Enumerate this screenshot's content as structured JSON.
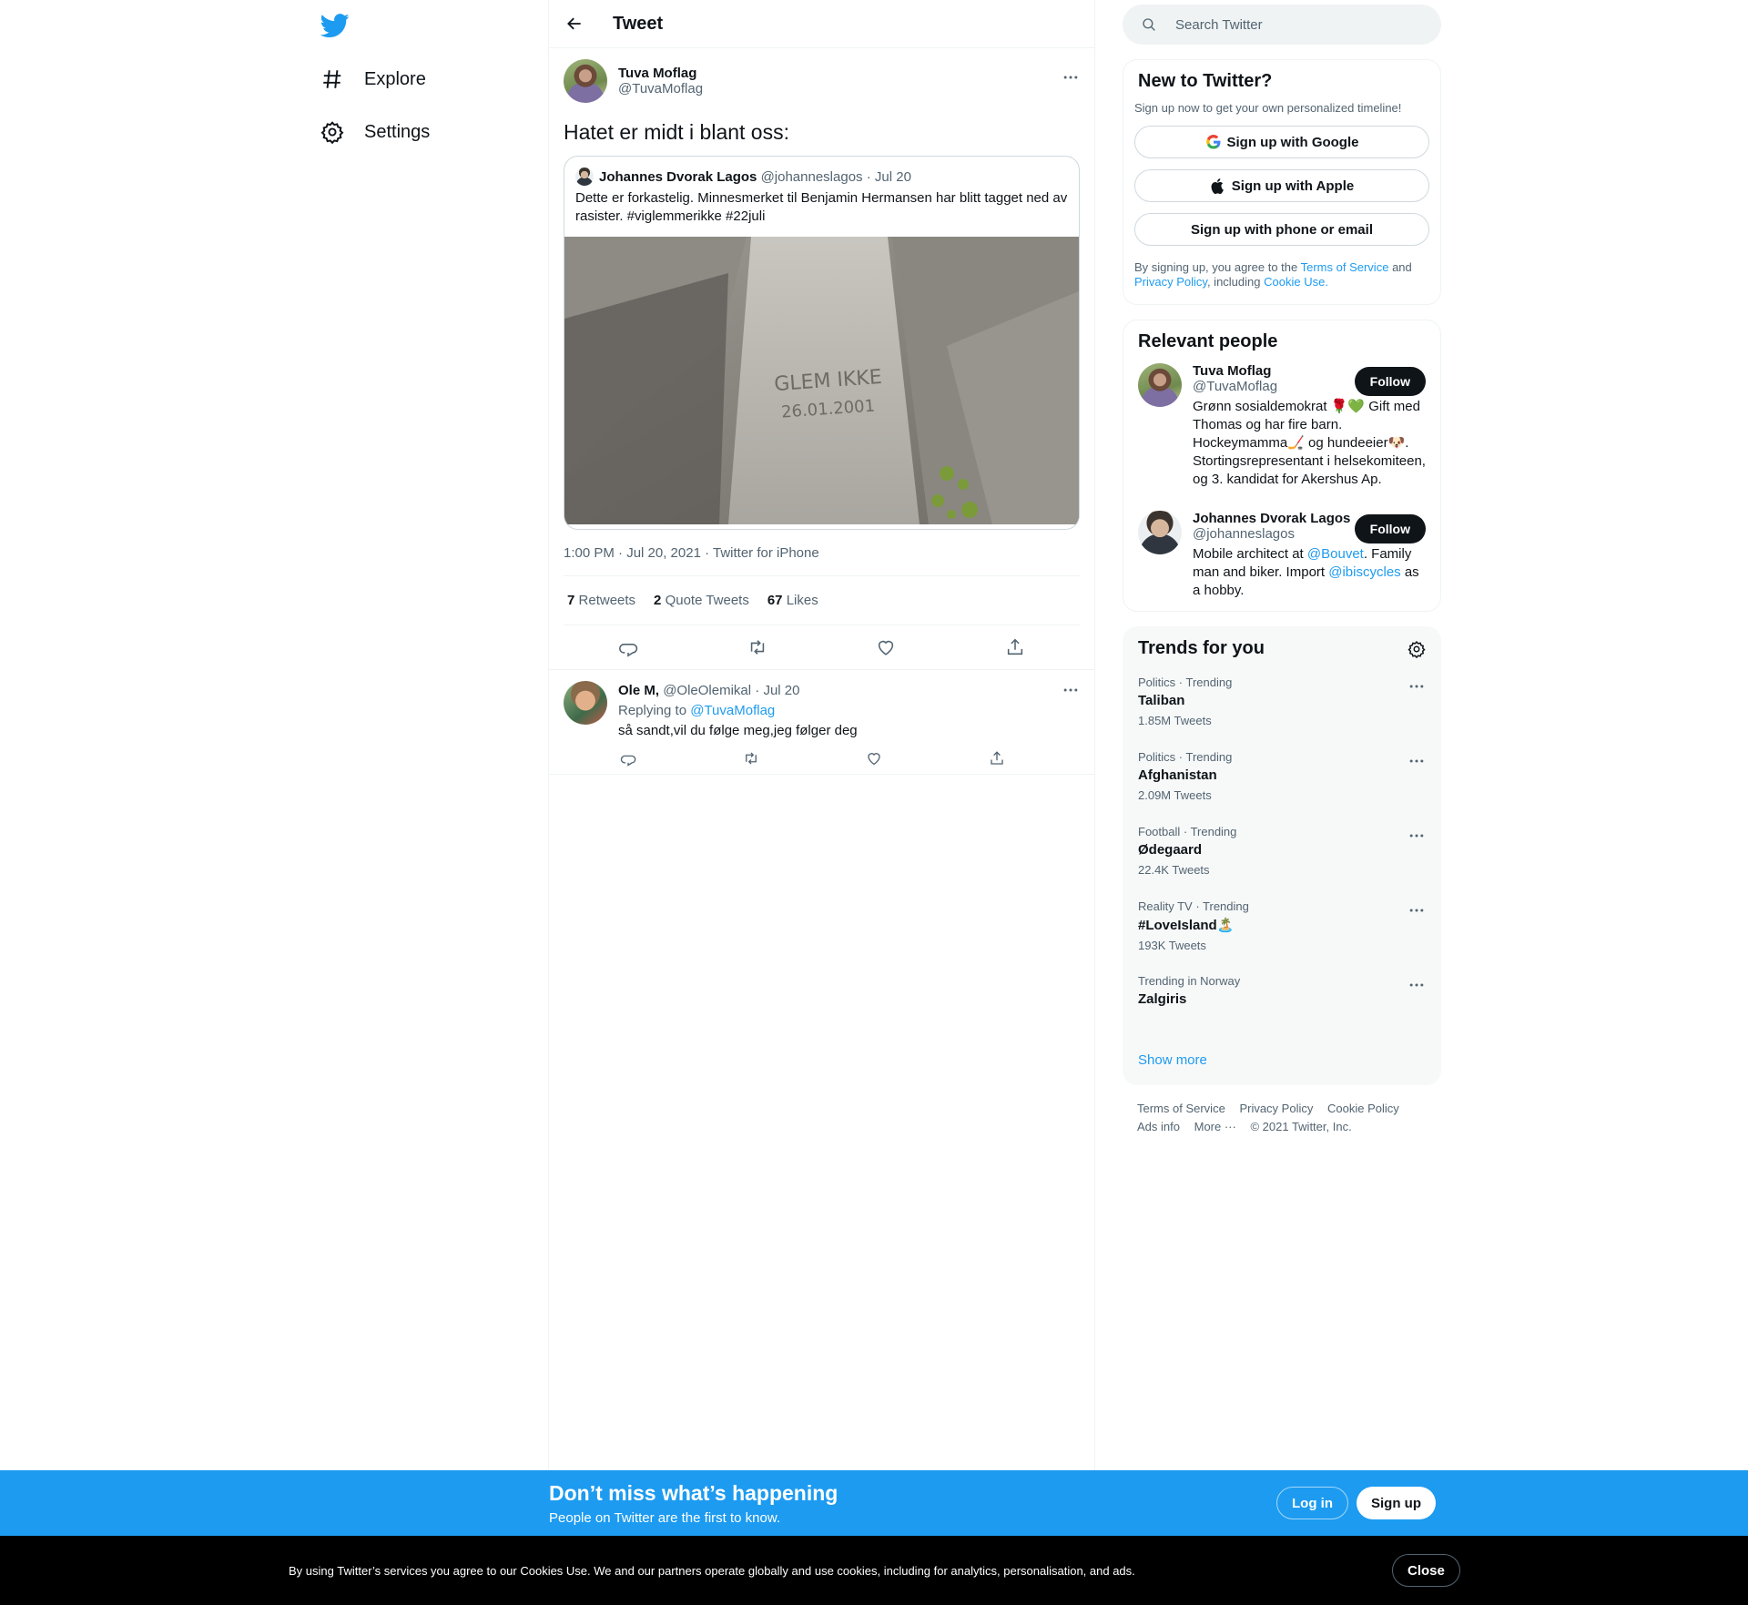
{
  "nav": {
    "items": [
      {
        "label": "Explore"
      },
      {
        "label": "Settings"
      }
    ]
  },
  "header": {
    "title": "Tweet"
  },
  "tweet": {
    "author_name": "Tuva Moflag",
    "author_handle": "@TuvaMoflag",
    "text": "Hatet er midt i blant oss:",
    "quote": {
      "author_name": "Johannes Dvorak Lagos",
      "author_handle": "@johanneslagos",
      "date": "· Jul 20",
      "text": "Dette er forkastelig. Minnesmerket til Benjamin Hermansen har blitt tagget ned av rasister. #viglemmerikke #22juli",
      "image_line1": "GLEM IKKE",
      "image_line2": "26.01.2001"
    },
    "meta": "1:00 PM · Jul 20, 2021 · Twitter for iPhone",
    "stats": {
      "retweets_count": "7",
      "retweets_label": "Retweets",
      "quotes_count": "2",
      "quotes_label": "Quote Tweets",
      "likes_count": "67",
      "likes_label": "Likes"
    }
  },
  "reply": {
    "author_name": "Ole M,",
    "author_handle": "@OleOlemikal",
    "date": "· Jul 20",
    "replying_prefix": "Replying to",
    "replying_to": "@TuvaMoflag",
    "text": "så sandt,vil du følge meg,jeg følger deg"
  },
  "search": {
    "placeholder": "Search Twitter"
  },
  "new_to_twitter": {
    "title": "New to Twitter?",
    "subtitle": "Sign up now to get your own personalized timeline!",
    "google": "Sign up with Google",
    "apple": "Sign up with Apple",
    "phone": "Sign up with phone or email",
    "terms_pre": "By signing up, you agree to the",
    "terms_link": "Terms of Service",
    "terms_and": "and",
    "privacy_link": "Privacy Policy",
    "terms_including": ", including",
    "cookie_link": "Cookie Use."
  },
  "relevant_people": {
    "title": "Relevant people",
    "people": [
      {
        "name": "Tuva Moflag",
        "handle": "@TuvaMoflag",
        "bio": "Grønn sosialdemokrat 🌹💚 Gift med Thomas og har fire barn. Hockeymamma🏒 og hundeeier🐶. Stortingsrepresentant i helsekomiteen, og 3. kandidat for Akershus Ap.",
        "follow": "Follow"
      },
      {
        "name": "Johannes Dvorak Lagos",
        "handle": "@johanneslagos",
        "bio_pre": "Mobile architect at",
        "bio_link1": "@Bouvet",
        "bio_mid": ". Family man and biker. Import",
        "bio_link2": "@ibiscycles",
        "bio_post": "as a hobby.",
        "follow": "Follow"
      }
    ]
  },
  "trends": {
    "title": "Trends for you",
    "items": [
      {
        "category": "Politics · Trending",
        "name": "Taliban",
        "count": "1.85M Tweets"
      },
      {
        "category": "Politics · Trending",
        "name": "Afghanistan",
        "count": "2.09M Tweets"
      },
      {
        "category": "Football · Trending",
        "name": "Ødegaard",
        "count": "22.4K Tweets"
      },
      {
        "category": "Reality TV · Trending",
        "name": "#LoveIsland🏝️",
        "count": "193K Tweets"
      },
      {
        "category": "Trending in Norway",
        "name": "Zalgiris",
        "count": ""
      }
    ],
    "show_more": "Show more"
  },
  "footer": {
    "links": [
      "Terms of Service",
      "Privacy Policy",
      "Cookie Policy",
      "Ads info",
      "More ···",
      "© 2021 Twitter, Inc."
    ]
  },
  "signup_bar": {
    "title": "Don’t miss what’s happening",
    "subtitle": "People on Twitter are the first to know.",
    "login": "Log in",
    "signup": "Sign up"
  },
  "cookie_bar": {
    "text": "By using Twitter’s services you agree to our Cookies Use. We and our partners operate globally and use cookies, including for analytics, personalisation, and ads.",
    "close": "Close"
  },
  "colors": {
    "accent": "#1d9bf0",
    "text": "#0f1419",
    "muted": "#536471"
  }
}
